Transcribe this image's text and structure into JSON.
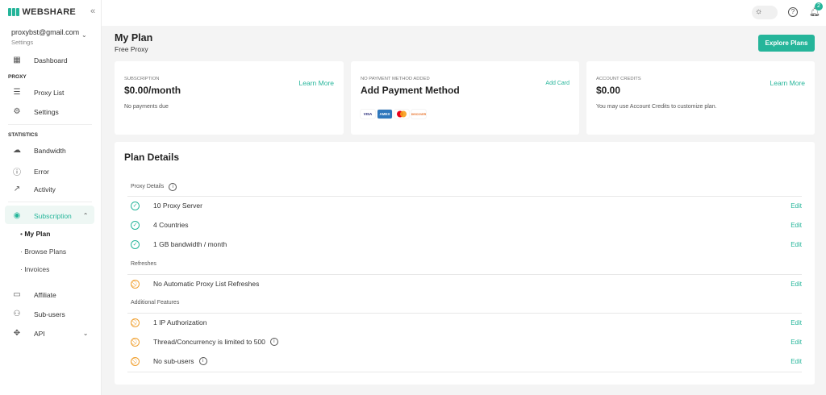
{
  "brand": "WEBSHARE",
  "account": {
    "email": "proxybst@gmail.com",
    "settings": "Settings"
  },
  "sidebar": {
    "dashboard": "Dashboard",
    "proxy_section": "PROXY",
    "proxy_list": "Proxy List",
    "settings": "Settings",
    "stats_section": "STATISTICS",
    "bandwidth": "Bandwidth",
    "error": "Error",
    "activity": "Activity",
    "subscription": "Subscription",
    "my_plan": "My Plan",
    "browse_plans": "Browse Plans",
    "invoices": "Invoices",
    "affiliate": "Affiliate",
    "sub_users": "Sub-users",
    "api": "API"
  },
  "topbar": {
    "notifications": "2"
  },
  "header": {
    "title": "My Plan",
    "subtitle": "Free Proxy",
    "explore": "Explore Plans"
  },
  "cards": [
    {
      "label": "SUBSCRIPTION",
      "value": "$0.00/month",
      "note": "No payments due",
      "link": "Learn More"
    },
    {
      "label": "NO PAYMENT METHOD ADDED",
      "value": "Add Payment Method",
      "link": "Add Card",
      "cards": [
        "VISA",
        "AMEX",
        "MC",
        "DISCOVER"
      ]
    },
    {
      "label": "ACCOUNT CREDITS",
      "value": "$0.00",
      "note": "You may use Account Credits to customize plan.",
      "link": "Learn More"
    }
  ],
  "plan": {
    "title": "Plan Details",
    "edit": "Edit",
    "proxy_details": "Proxy Details",
    "refreshes": "Refreshes",
    "additional": "Additional Features",
    "rows": [
      "10 Proxy Server",
      "4 Countries",
      "1 GB bandwidth / month",
      "No Automatic Proxy List Refreshes",
      "1 IP Authorization",
      "Thread/Concurrency is limited to 500",
      "No sub-users"
    ]
  },
  "colors": {
    "accent": "#25b59a",
    "warning": "#f0a030"
  }
}
